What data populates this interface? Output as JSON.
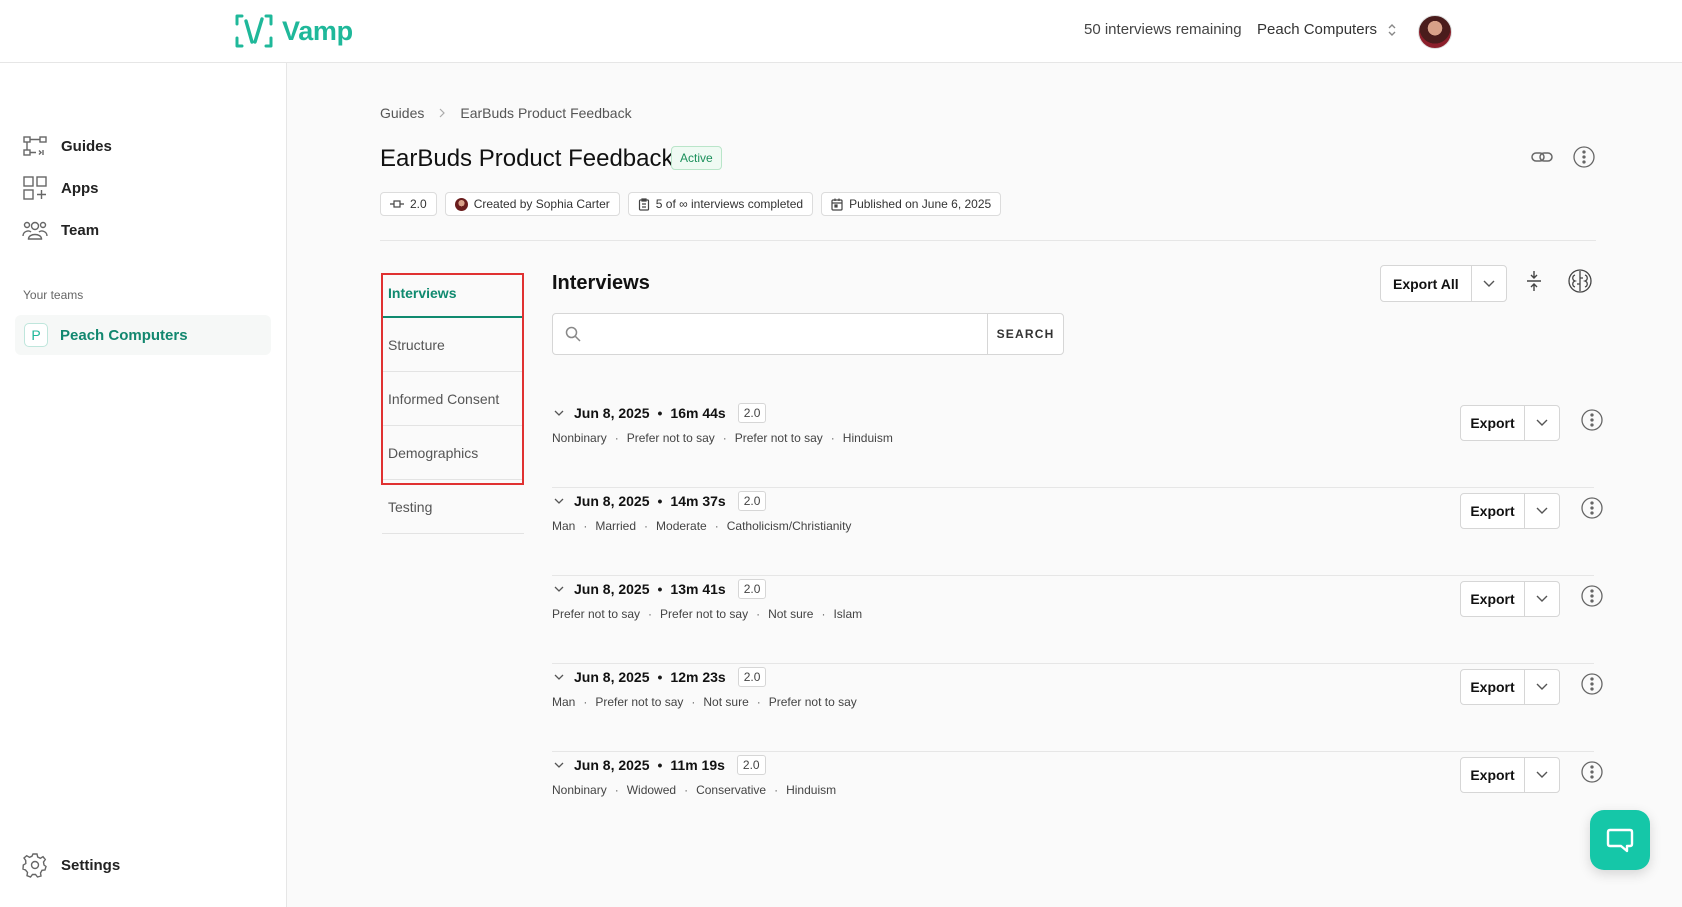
{
  "app": {
    "name": "Vamp",
    "brand_color": "#1fb89a"
  },
  "topbar": {
    "remaining": "50 interviews remaining",
    "org": "Peach Computers"
  },
  "sidebar": {
    "items": [
      {
        "label": "Guides",
        "icon": "guides-icon"
      },
      {
        "label": "Apps",
        "icon": "apps-icon"
      },
      {
        "label": "Team",
        "icon": "team-icon"
      }
    ],
    "teams_label": "Your teams",
    "team": {
      "badge": "P",
      "name": "Peach Computers"
    },
    "settings": "Settings"
  },
  "breadcrumb": [
    "Guides",
    "EarBuds Product Feedback"
  ],
  "guide": {
    "title": "EarBuds Product Feedback",
    "status": "Active",
    "version": "2.0",
    "created_by": "Created by Sophia Carter",
    "completed": "5 of ∞ interviews completed",
    "published": "Published on June 6, 2025"
  },
  "tabs": [
    "Interviews",
    "Structure",
    "Informed Consent",
    "Demographics",
    "Testing"
  ],
  "interviews": {
    "title": "Interviews",
    "search_button": "SEARCH",
    "search_placeholder": "",
    "export_all": "Export All",
    "export_label": "Export",
    "rows": [
      {
        "date": "Jun 8, 2025",
        "duration": "16m 44s",
        "version": "2.0",
        "tags": [
          "Nonbinary",
          "Prefer not to say",
          "Prefer not to say",
          "Hinduism"
        ]
      },
      {
        "date": "Jun 8, 2025",
        "duration": "14m 37s",
        "version": "2.0",
        "tags": [
          "Man",
          "Married",
          "Moderate",
          "Catholicism/Christianity"
        ]
      },
      {
        "date": "Jun 8, 2025",
        "duration": "13m 41s",
        "version": "2.0",
        "tags": [
          "Prefer not to say",
          "Prefer not to say",
          "Not sure",
          "Islam"
        ]
      },
      {
        "date": "Jun 8, 2025",
        "duration": "12m 23s",
        "version": "2.0",
        "tags": [
          "Man",
          "Prefer not to say",
          "Not sure",
          "Prefer not to say"
        ]
      },
      {
        "date": "Jun 8, 2025",
        "duration": "11m 19s",
        "version": "2.0",
        "tags": [
          "Nonbinary",
          "Widowed",
          "Conservative",
          "Hinduism"
        ]
      }
    ]
  }
}
